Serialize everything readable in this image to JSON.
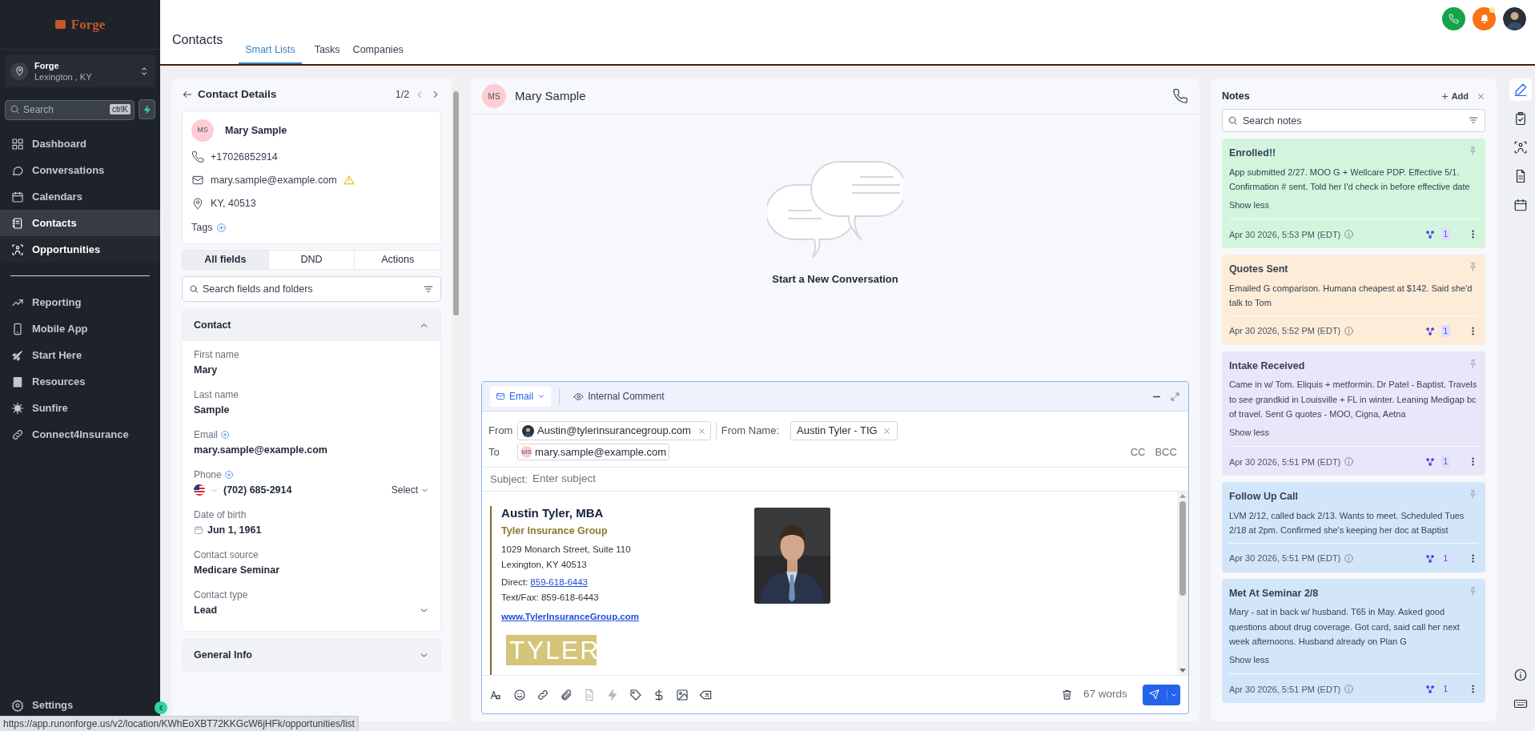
{
  "sidebar": {
    "brand": "Forge",
    "account": {
      "name": "Forge",
      "location": "Lexington , KY"
    },
    "search": {
      "placeholder": "Search",
      "shortcut": "ctrlK"
    },
    "nav": [
      {
        "label": "Dashboard",
        "selected": false,
        "hovered": false
      },
      {
        "label": "Conversations",
        "selected": false,
        "hovered": false
      },
      {
        "label": "Calendars",
        "selected": false,
        "hovered": false
      },
      {
        "label": "Contacts",
        "selected": true,
        "hovered": false
      },
      {
        "label": "Opportunities",
        "selected": false,
        "hovered": true
      }
    ],
    "nav_secondary": [
      {
        "label": "Reporting",
        "selected": false,
        "hovered": false
      },
      {
        "label": "Mobile App",
        "selected": false,
        "hovered": false
      },
      {
        "label": "Start Here",
        "selected": false,
        "hovered": false
      },
      {
        "label": "Resources",
        "selected": false,
        "hovered": false
      },
      {
        "label": "Sunfire",
        "selected": false,
        "hovered": false
      },
      {
        "label": "Connect4Insurance",
        "selected": false,
        "hovered": false
      }
    ],
    "settings": "Settings"
  },
  "status_url": "https://app.runonforge.us/v2/location/KWhEoXBT72KKGcW6jHFk/opportunities/list",
  "header": {
    "title": "Contacts",
    "tabs": [
      {
        "label": "Smart Lists",
        "selected": true
      },
      {
        "label": "Tasks",
        "selected": false
      },
      {
        "label": "Companies",
        "selected": false
      }
    ],
    "unread_notifications": true
  },
  "contact_panel": {
    "title": "Contact Details",
    "pager": "1/2",
    "card": {
      "initials": "MS",
      "name": "Mary Sample",
      "phone": "+17026852914",
      "email": "mary.sample@example.com",
      "email_warning": true,
      "location": "KY, 40513",
      "tags_label": "Tags"
    },
    "field_tabs": [
      {
        "label": "All fields",
        "selected": true
      },
      {
        "label": "DND",
        "selected": false
      },
      {
        "label": "Actions",
        "selected": false
      }
    ],
    "search_placeholder": "Search fields and folders",
    "sections": [
      {
        "title": "Contact",
        "expanded": true,
        "fields": [
          {
            "label": "First name",
            "value": "Mary",
            "kind": "text",
            "addable": false
          },
          {
            "label": "Last name",
            "value": "Sample",
            "kind": "text",
            "addable": false
          },
          {
            "label": "Email",
            "value": "mary.sample@example.com",
            "kind": "text",
            "addable": true
          },
          {
            "label": "Phone",
            "value": "(702) 685-2914",
            "kind": "phone",
            "addable": true,
            "select": "Select"
          },
          {
            "label": "Date of birth",
            "value": "Jun 1, 1961",
            "kind": "date",
            "addable": false
          },
          {
            "label": "Contact source",
            "value": "Medicare Seminar",
            "kind": "text",
            "addable": false
          },
          {
            "label": "Contact type",
            "value": "Lead",
            "kind": "dropdown",
            "addable": false
          }
        ]
      },
      {
        "title": "General Info",
        "expanded": false
      }
    ]
  },
  "conversation": {
    "initials": "MS",
    "name": "Mary Sample",
    "empty_text": "Start a New Conversation",
    "composer": {
      "channels": [
        {
          "label": "Email",
          "selected": true
        },
        {
          "label": "Internal Comment",
          "selected": false
        }
      ],
      "from_label": "From",
      "from": "Austin@tylerinsurancegroup.com",
      "from_name_label": "From Name:",
      "from_name": "Austin Tyler - TIG",
      "to_label": "To",
      "to_initials": "MS",
      "to": "mary.sample@example.com",
      "cc": "CC",
      "bcc": "BCC",
      "subject_label": "Subject:",
      "subject_placeholder": "Enter subject",
      "signature": {
        "name": "Austin Tyler, MBA",
        "company": "Tyler Insurance Group",
        "address": [
          "1029 Monarch Street, Suite 110",
          "Lexington, KY 40513"
        ],
        "direct_label": "Direct:",
        "direct": "859-618-6443",
        "fax": "Text/Fax: 859-618-6443",
        "website": "www.TylerInsuranceGroup.com",
        "logo": "TYLER"
      },
      "word_count": "67 words"
    }
  },
  "notes": {
    "title": "Notes",
    "add": "Add",
    "search_placeholder": "Search notes",
    "items": [
      {
        "title": "Enrolled!!",
        "body": "App submitted 2/27. MOO G + Wellcare PDP. Effective 5/1. Confirmation # sent. Told her I'd check in before effective date",
        "toggle": "Show less",
        "date": "Apr 30 2026, 5:53 PM (EDT)",
        "count": "1",
        "color": "#d3f5de"
      },
      {
        "title": "Quotes Sent",
        "body": "Emailed G comparison. Humana cheapest at $142. Said she'd talk to Tom",
        "date": "Apr 30 2026, 5:52 PM (EDT)",
        "count": "1",
        "color": "#fdecd7"
      },
      {
        "title": "Intake Received",
        "body": "Came in w/ Tom. Eliquis + metformin. Dr Patel - Baptist. Travels to see grandkid in Louisville + FL in winter. Leaning Medigap bc of travel. Sent G quotes - MOO, Cigna, Aetna",
        "toggle": "Show less",
        "date": "Apr 30 2026, 5:51 PM (EDT)",
        "count": "1",
        "color": "#e9e6f9"
      },
      {
        "title": "Follow Up Call",
        "body": "LVM 2/12, called back 2/13. Wants to meet. Scheduled Tues 2/18 at 2pm. Confirmed she's keeping her doc at Baptist",
        "date": "Apr 30 2026, 5:51 PM (EDT)",
        "count": "1",
        "color": "#d3e6f9"
      },
      {
        "title": "Met At Seminar 2/8",
        "body": "Mary - sat in back w/ husband. T65 in May. Asked good questions about drug coverage. Got card, said call her next week afternoons. Husband already on Plan G",
        "toggle": "Show less",
        "date": "Apr 30 2026, 5:51 PM (EDT)",
        "count": "1",
        "color": "#d3e6f9"
      }
    ]
  },
  "rail": [
    {
      "selected": true
    },
    {
      "selected": false
    },
    {
      "selected": false
    },
    {
      "selected": false
    },
    {
      "selected": false
    }
  ],
  "rail_bottom": [
    {
      "selected": false
    },
    {
      "selected": false
    }
  ]
}
